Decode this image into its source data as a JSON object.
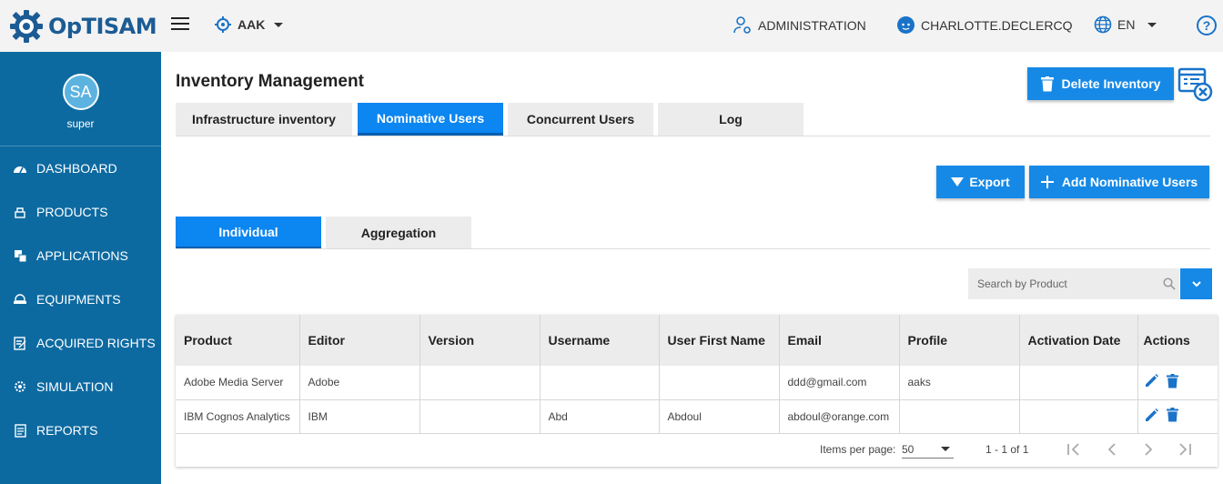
{
  "app": {
    "name": "OpTISAM"
  },
  "header": {
    "tenant": "AAK",
    "administration": "ADMINISTRATION",
    "user": "CHARLOTTE.DECLERCQ",
    "language": "EN",
    "help": "?"
  },
  "sidebar": {
    "avatar_initials": "SA",
    "username": "super",
    "items": [
      {
        "label": "DASHBOARD",
        "icon": "dashboard-icon"
      },
      {
        "label": "PRODUCTS",
        "icon": "products-icon"
      },
      {
        "label": "APPLICATIONS",
        "icon": "applications-icon"
      },
      {
        "label": "EQUIPMENTS",
        "icon": "equipments-icon"
      },
      {
        "label": "ACQUIRED RIGHTS",
        "icon": "acquired-rights-icon"
      },
      {
        "label": "SIMULATION",
        "icon": "simulation-icon"
      },
      {
        "label": "REPORTS",
        "icon": "reports-icon"
      }
    ]
  },
  "main": {
    "title": "Inventory Management",
    "delete_inventory": "Delete Inventory",
    "tabs": [
      "Infrastructure inventory",
      "Nominative Users",
      "Concurrent Users",
      "Log"
    ],
    "active_tab": "Nominative Users",
    "export": "Export",
    "add_nominative_users": "Add Nominative Users",
    "subtabs": [
      "Individual",
      "Aggregation"
    ],
    "active_subtab": "Individual",
    "search_placeholder": "Search by Product"
  },
  "table": {
    "columns": [
      "Product",
      "Editor",
      "Version",
      "Username",
      "User First Name",
      "Email",
      "Profile",
      "Activation Date",
      "Actions"
    ],
    "rows": [
      [
        "Adobe Media Server",
        "Adobe",
        "",
        "",
        "",
        "ddd@gmail.com",
        "aaks",
        ""
      ],
      [
        "IBM Cognos Analytics",
        "IBM",
        "",
        "Abd",
        "Abdoul",
        "abdoul@orange.com",
        "",
        ""
      ]
    ]
  },
  "paginator": {
    "items_per_page_label": "Items per page:",
    "items_per_page": "50",
    "range": "1 - 1 of 1"
  },
  "colors": {
    "primary": "#1689e6",
    "sidebar": "#0d6aa1",
    "brand": "#1c5c95"
  }
}
